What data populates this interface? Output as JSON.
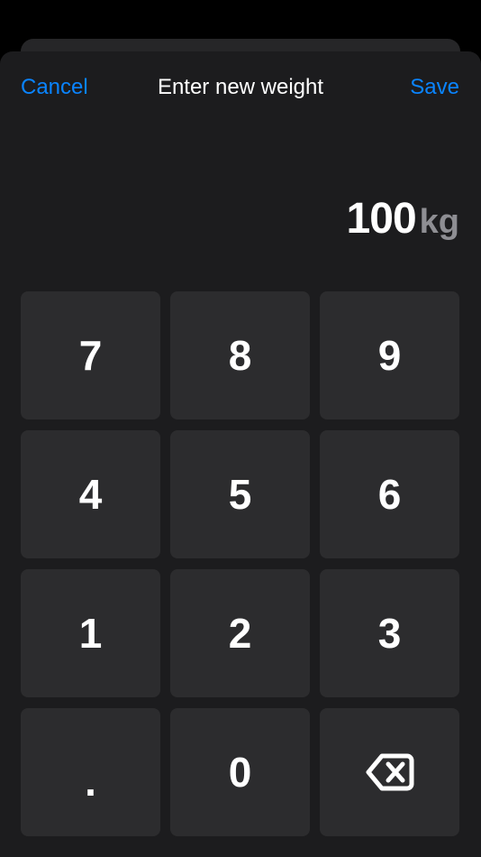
{
  "nav": {
    "cancel_label": "Cancel",
    "title": "Enter new weight",
    "save_label": "Save"
  },
  "readout": {
    "value": "100",
    "unit": "kg"
  },
  "keypad": {
    "keys": [
      "7",
      "8",
      "9",
      "4",
      "5",
      "6",
      "1",
      "2",
      "3",
      ".",
      "0"
    ],
    "backspace_icon": "backspace-icon"
  },
  "colors": {
    "accent": "#0a84ff",
    "sheet_background": "#1c1c1e",
    "key_background": "#2c2c2e",
    "unit_text": "#8e8e93"
  }
}
